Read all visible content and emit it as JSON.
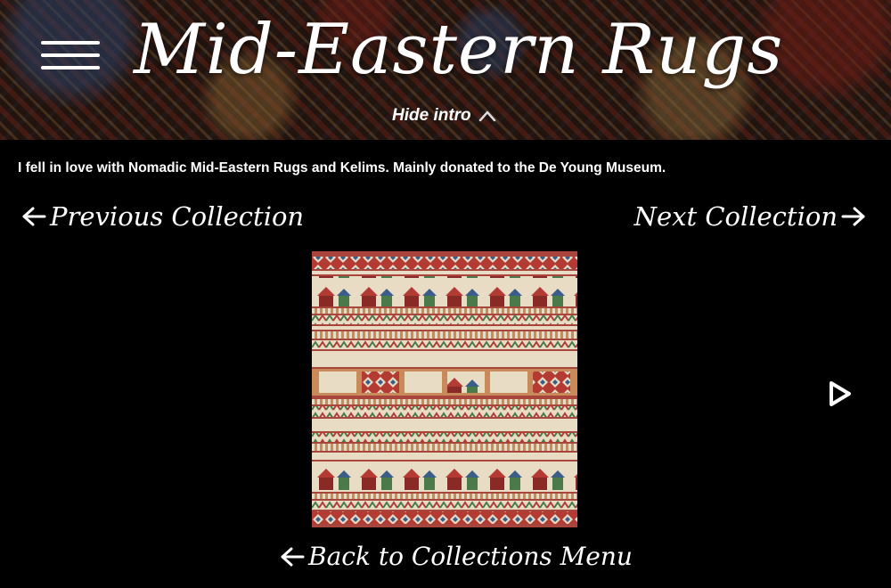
{
  "header": {
    "title": "Mid-Eastern Rugs",
    "hide_intro_label": "Hide intro",
    "menu_icon": "hamburger-menu-icon",
    "hide_icon": "chevron-up-icon"
  },
  "intro": {
    "text": "I fell in love with Nomadic Mid-Eastern Rugs and Kelims. Mainly donated to the De Young Museum."
  },
  "navigation": {
    "previous_label": "Previous Collection",
    "next_label": "Next Collection",
    "back_label": "Back to Collections Menu",
    "arrow_left_icon": "arrow-left-icon",
    "arrow_right_icon": "arrow-right-icon"
  },
  "gallery": {
    "image_subject": "kelim-rug",
    "play_icon": "play-icon"
  },
  "colors": {
    "background": "#000000",
    "text": "#ffffff",
    "rug_red": "#a8453c",
    "rug_cream": "#e8dcc4"
  }
}
